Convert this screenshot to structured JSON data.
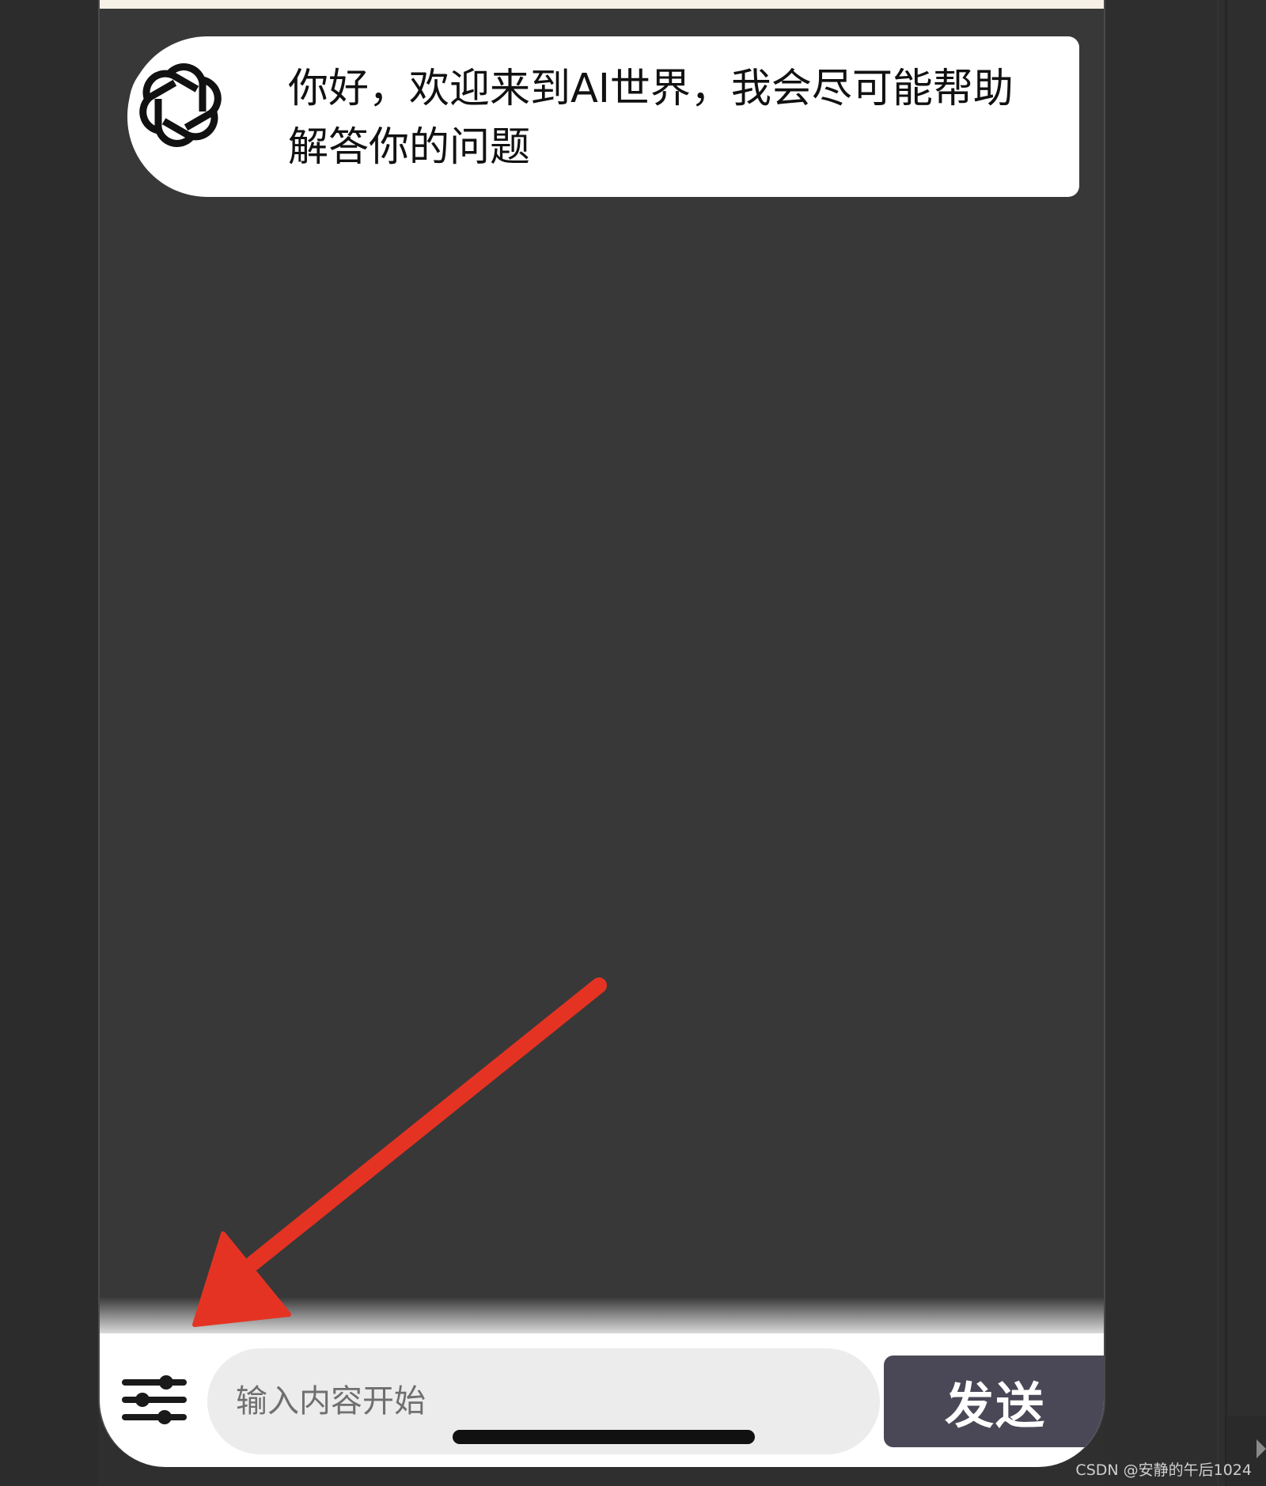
{
  "chat": {
    "messages": [
      {
        "sender": "ai",
        "avatar_icon": "openai-logo-icon",
        "text": "你好，欢迎来到AI世界，我会尽可能帮助解答你的问题"
      }
    ]
  },
  "composer": {
    "settings_icon": "sliders-icon",
    "input_placeholder": "输入内容开始",
    "input_value": "",
    "send_label": "发送"
  },
  "annotation": {
    "arrow_color": "#e53323"
  },
  "watermark": {
    "text": "CSDN @安静的午后1024"
  },
  "colors": {
    "page_background": "#2f2f2f",
    "chat_background": "#383838",
    "bubble_background": "#ffffff",
    "send_button": "#4a4857",
    "input_background": "#ececec"
  }
}
